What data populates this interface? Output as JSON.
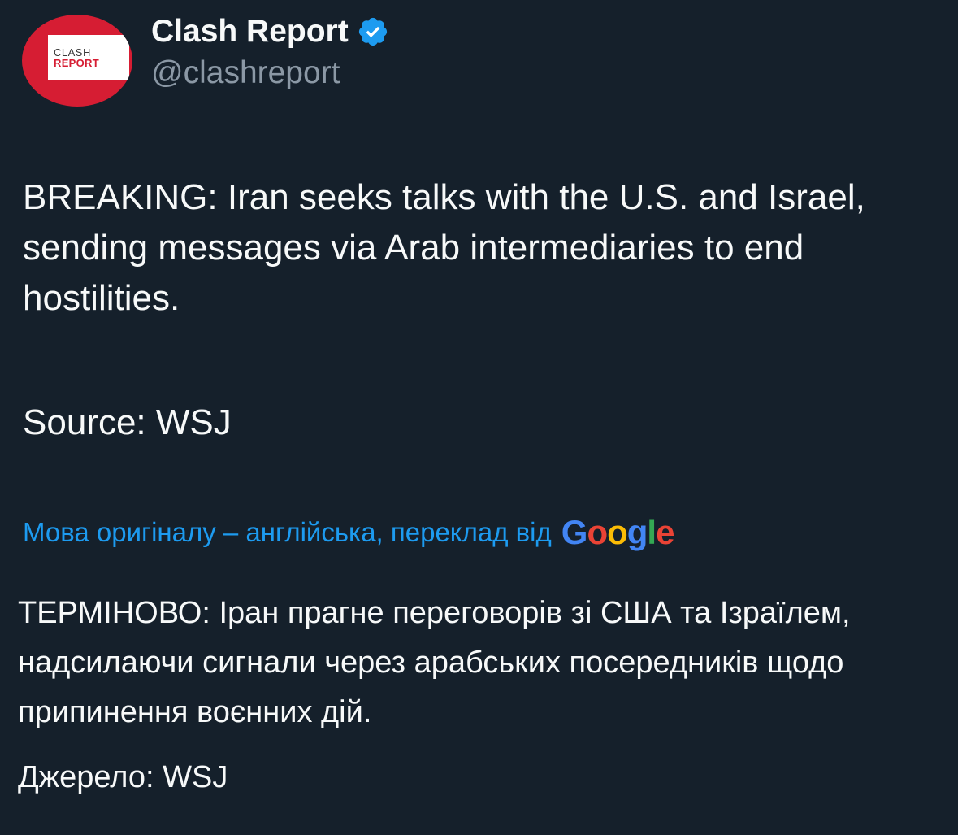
{
  "author": {
    "avatar_line1": "CLASH",
    "avatar_line2": "REPORT",
    "display_name": "Clash Report",
    "handle": "@clashreport",
    "verified_icon": "verified-badge-icon"
  },
  "tweet": {
    "text": "BREAKING: Iran seeks talks with the U.S. and Israel, sending messages via Arab intermediaries to end hostilities.",
    "source": "Source: WSJ"
  },
  "translation": {
    "note": "Мова оригіналу – англійська, переклад від",
    "provider_letters": [
      "G",
      "o",
      "o",
      "g",
      "l",
      "e"
    ],
    "text": "ТЕРМІНОВО: Іран прагне переговорів зі США та Ізраїлем, надсилаючи сигнали через арабських посередників щодо припинення воєнних дій.",
    "source": "Джерело: WSJ"
  },
  "colors": {
    "background": "#15202b",
    "text_primary": "#f7f9f9",
    "text_secondary": "#8b98a5",
    "link_blue": "#1d9bf0",
    "verified_blue": "#1d9bf0",
    "avatar_red": "#d61d33",
    "google_blue": "#4285f4",
    "google_red": "#ea4335",
    "google_yellow": "#fbbc05",
    "google_green": "#34a853"
  }
}
